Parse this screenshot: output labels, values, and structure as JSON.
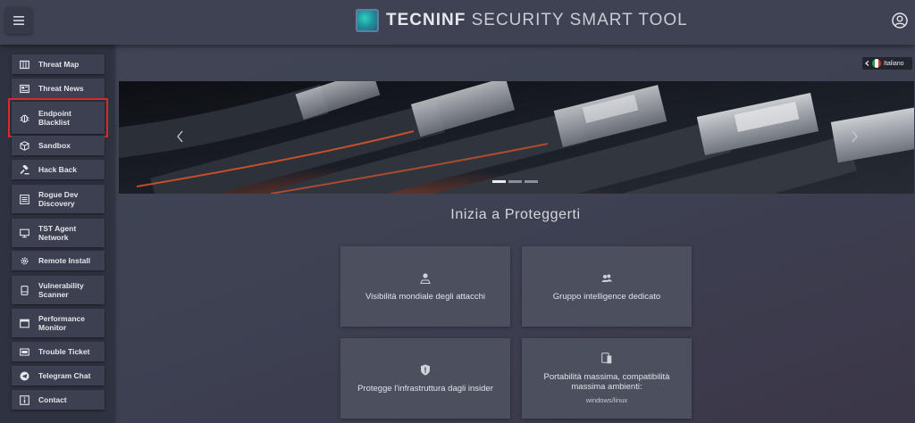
{
  "header": {
    "brand_bold": "TECNINF",
    "brand_rest": "SECURITY SMART TOOL"
  },
  "sidebar": {
    "items": [
      {
        "label": "Threat Map",
        "icon": "map-icon"
      },
      {
        "label": "Threat News",
        "icon": "newspaper-icon"
      },
      {
        "label": "Endpoint Blacklist",
        "icon": "bug-icon",
        "selected": true
      },
      {
        "label": "Sandbox",
        "icon": "cube-icon"
      },
      {
        "label": "Hack Back",
        "icon": "gavel-icon"
      },
      {
        "label": "Rogue Dev Discovery",
        "icon": "list-icon"
      },
      {
        "label": "TST Agent Network",
        "icon": "monitor-icon"
      },
      {
        "label": "Remote Install",
        "icon": "gear-icon"
      },
      {
        "label": "Vulnerability Scanner",
        "icon": "server-icon"
      },
      {
        "label": "Performance Monitor",
        "icon": "window-icon"
      },
      {
        "label": "Trouble Ticket",
        "icon": "ticket-icon"
      },
      {
        "label": "Telegram Chat",
        "icon": "telegram-icon"
      },
      {
        "label": "Contact",
        "icon": "info-icon"
      }
    ]
  },
  "language": {
    "label": "Italiano"
  },
  "main": {
    "section_title": "Inizia a Proteggerti",
    "cards": [
      {
        "text": "Visibilità mondiale degli attacchi",
        "icon": "user-location-icon"
      },
      {
        "text": "Gruppo intelligence dedicato",
        "icon": "users-icon"
      },
      {
        "text": "Protegge l'infrastruttura dagli insider",
        "icon": "shield-icon"
      },
      {
        "text": "Portabilità massima, compatibilità massima ambienti:",
        "sub": "windows/linux",
        "icon": "devices-icon"
      }
    ]
  },
  "colors": {
    "accent_selected": "#e0262a",
    "header_bg": "#3e4252",
    "sidebar_bg": "#2f3341",
    "card_bg": "#4b4f5e"
  }
}
